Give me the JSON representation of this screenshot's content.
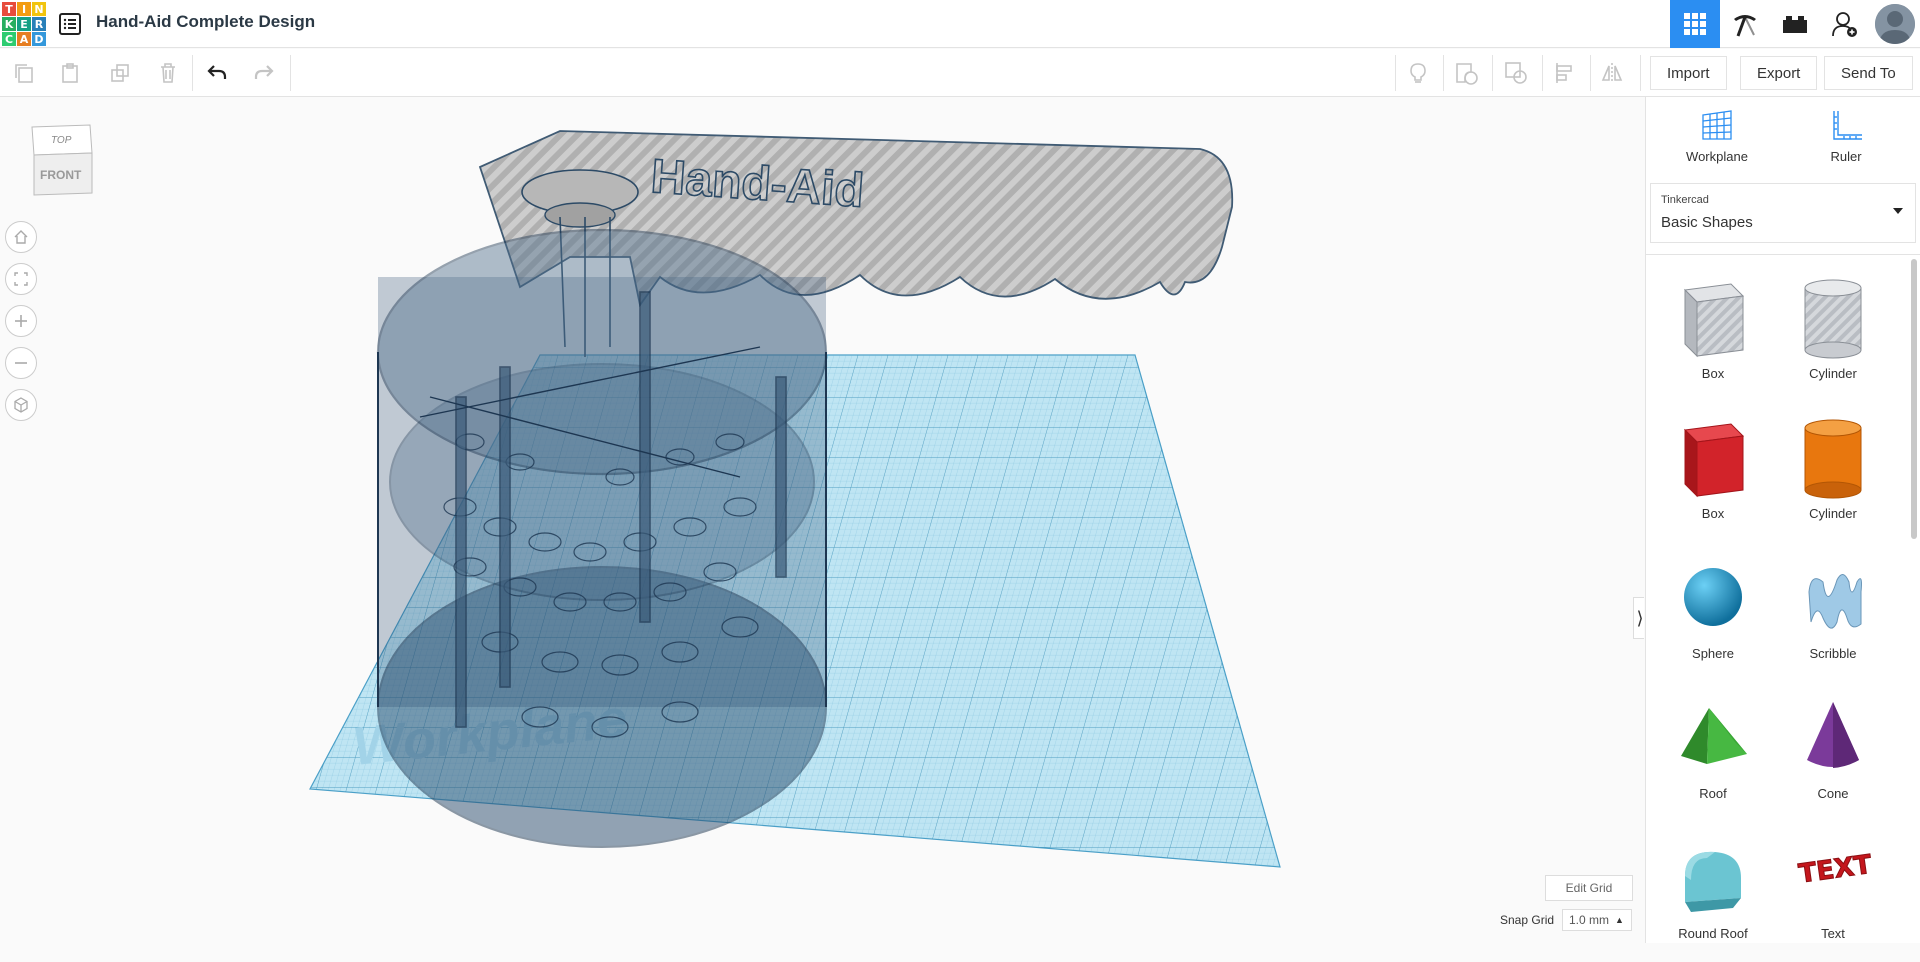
{
  "app": {
    "title": "Hand-Aid Complete Design",
    "logo_letters": [
      "T",
      "I",
      "N",
      "K",
      "E",
      "R",
      "C",
      "A",
      "D"
    ],
    "logo_colors": [
      "#e74c3c",
      "#f39c12",
      "#f1c40f",
      "#27ae60",
      "#16a085",
      "#2980b9",
      "#2ecc71",
      "#e67e22",
      "#3498db"
    ]
  },
  "toolbar": {
    "import_label": "Import",
    "export_label": "Export",
    "send_to_label": "Send To"
  },
  "viewcube": {
    "top_label": "TOP",
    "front_label": "FRONT"
  },
  "grid": {
    "edit_grid_label": "Edit Grid",
    "snap_grid_label": "Snap Grid",
    "snap_value": "1.0 mm"
  },
  "workplane_text": "Workplane",
  "panel": {
    "tools": [
      {
        "label": "Workplane",
        "icon": "workplane-icon"
      },
      {
        "label": "Ruler",
        "icon": "ruler-icon"
      }
    ],
    "library_source": "Tinkercad",
    "library_name": "Basic Shapes",
    "shapes": [
      {
        "label": "Box",
        "kind": "box-hole"
      },
      {
        "label": "Cylinder",
        "kind": "cylinder-hole"
      },
      {
        "label": "Box",
        "kind": "box-solid"
      },
      {
        "label": "Cylinder",
        "kind": "cylinder-solid"
      },
      {
        "label": "Sphere",
        "kind": "sphere"
      },
      {
        "label": "Scribble",
        "kind": "scribble"
      },
      {
        "label": "Roof",
        "kind": "roof"
      },
      {
        "label": "Cone",
        "kind": "cone"
      },
      {
        "label": "Round Roof",
        "kind": "round-roof"
      },
      {
        "label": "Text",
        "kind": "text"
      }
    ]
  },
  "colors": {
    "accent": "#2b8ef2",
    "workplane": "#8ed0ea",
    "box_red": "#d2232a",
    "cylinder_orange": "#e8770e",
    "sphere_blue": "#1797d2",
    "roof_green": "#3aa635",
    "cone_purple": "#7b3a9a",
    "round_roof_teal": "#6bc5d2",
    "text_red": "#c4161c"
  }
}
